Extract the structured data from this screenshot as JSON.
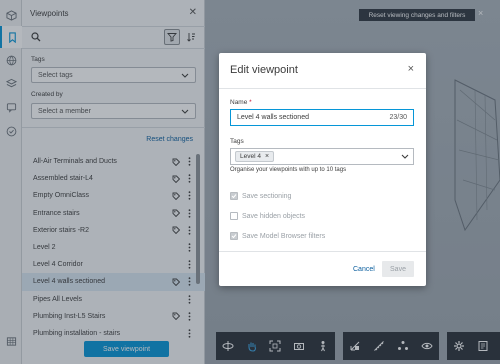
{
  "panel": {
    "title": "Viewpoints",
    "tags_label": "Tags",
    "tags_placeholder": "Select tags",
    "created_by_label": "Created by",
    "created_by_placeholder": "Select a member",
    "reset_link": "Reset changes",
    "save_viewpoint": "Save viewpoint",
    "items": [
      {
        "label": "All-Air Terminals and Ducts",
        "tag": true
      },
      {
        "label": "Assembled stair-L4",
        "tag": true
      },
      {
        "label": "Empty OmniClass",
        "tag": true
      },
      {
        "label": "Entrance stairs",
        "tag": true
      },
      {
        "label": "Exterior stairs -R2",
        "tag": true
      },
      {
        "label": "Level 2",
        "tag": false
      },
      {
        "label": "Level 4 Corridor",
        "tag": false
      },
      {
        "label": "Level 4 walls sectioned",
        "tag": true
      },
      {
        "label": "Pipes All Levels",
        "tag": false
      },
      {
        "label": "Plumbing Inst-L5 Stairs",
        "tag": true
      },
      {
        "label": "Plumbing installation - stairs",
        "tag": false
      }
    ]
  },
  "viewer": {
    "reset_pill": "Reset viewing changes and filters",
    "reset_close": "×"
  },
  "modal": {
    "title": "Edit viewpoint",
    "close": "×",
    "name_label": "Name",
    "required_mark": "*",
    "name_value": "Level 4 walls sectioned",
    "name_counter": "23/30",
    "tags_label": "Tags",
    "tag_chip": "Level 4",
    "tag_chip_remove": "×",
    "tags_hint": "Organise your viewpoints with up to 10 tags",
    "options": [
      {
        "label": "Save sectioning",
        "checked": true
      },
      {
        "label": "Save hidden objects",
        "checked": false
      },
      {
        "label": "Save Model Browser filters",
        "checked": true
      }
    ],
    "cancel": "Cancel",
    "save": "Save"
  },
  "colors": {
    "accent": "#0696d7",
    "link": "#0a5e9e",
    "toolbar_bg": "#2a3038"
  }
}
